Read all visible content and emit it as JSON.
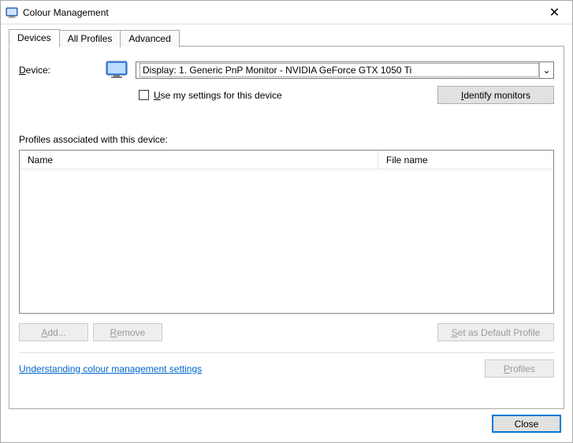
{
  "window": {
    "title": "Colour Management",
    "close_x": "✕"
  },
  "tabs": {
    "devices": "Devices",
    "all_profiles": "All Profiles",
    "advanced": "Advanced"
  },
  "device": {
    "label_prefix": "D",
    "label_rest": "evice:",
    "selected": "Display: 1. Generic PnP Monitor - NVIDIA GeForce GTX 1050 Ti"
  },
  "use_my_settings": {
    "u": "U",
    "rest": "se my settings for this device"
  },
  "identify": {
    "u": "I",
    "rest": "dentify monitors"
  },
  "profiles_label": "Profiles associated with this device:",
  "columns": {
    "name": "Name",
    "file_name": "File name"
  },
  "buttons": {
    "add_u": "A",
    "add_rest": "dd...",
    "remove_u": "R",
    "remove_rest": "emove",
    "set_default_u": "S",
    "set_default_rest": "et as Default Profile",
    "profiles_u": "P",
    "profiles_rest": "rofiles",
    "close": "Close"
  },
  "link": "Understanding colour management settings",
  "caret": "⌄"
}
